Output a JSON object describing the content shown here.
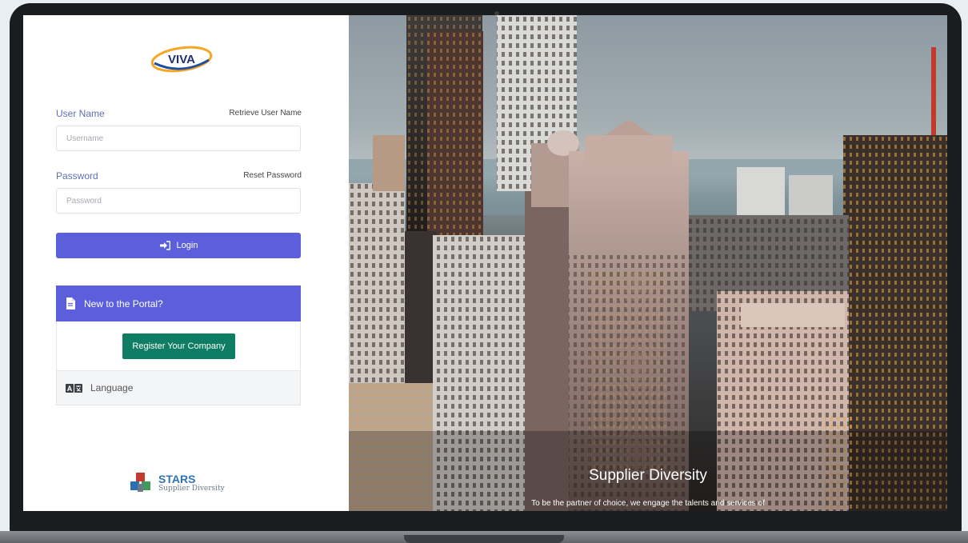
{
  "login": {
    "username_label": "User Name",
    "retrieve_username_link": "Retrieve User Name",
    "username_placeholder": "Username",
    "password_label": "Password",
    "reset_password_link": "Reset Password",
    "password_placeholder": "Password",
    "login_button": "Login"
  },
  "portal_card": {
    "header": "New to the Portal?",
    "register_button": "Register Your Company",
    "language_label": "Language"
  },
  "branding": {
    "logo_text": "VIVA",
    "footer_title": "STARS",
    "footer_subtitle": "Supplier Diversity"
  },
  "hero": {
    "title": "Supplier Diversity",
    "text": "To be the partner of choice, we engage the talents and services of"
  },
  "colors": {
    "primary": "#5b5fdc",
    "register": "#0f7d63",
    "label": "#5f6fb3"
  },
  "icons": {
    "login": "sign-in-icon",
    "portal": "document-icon",
    "language": "translate-icon"
  }
}
